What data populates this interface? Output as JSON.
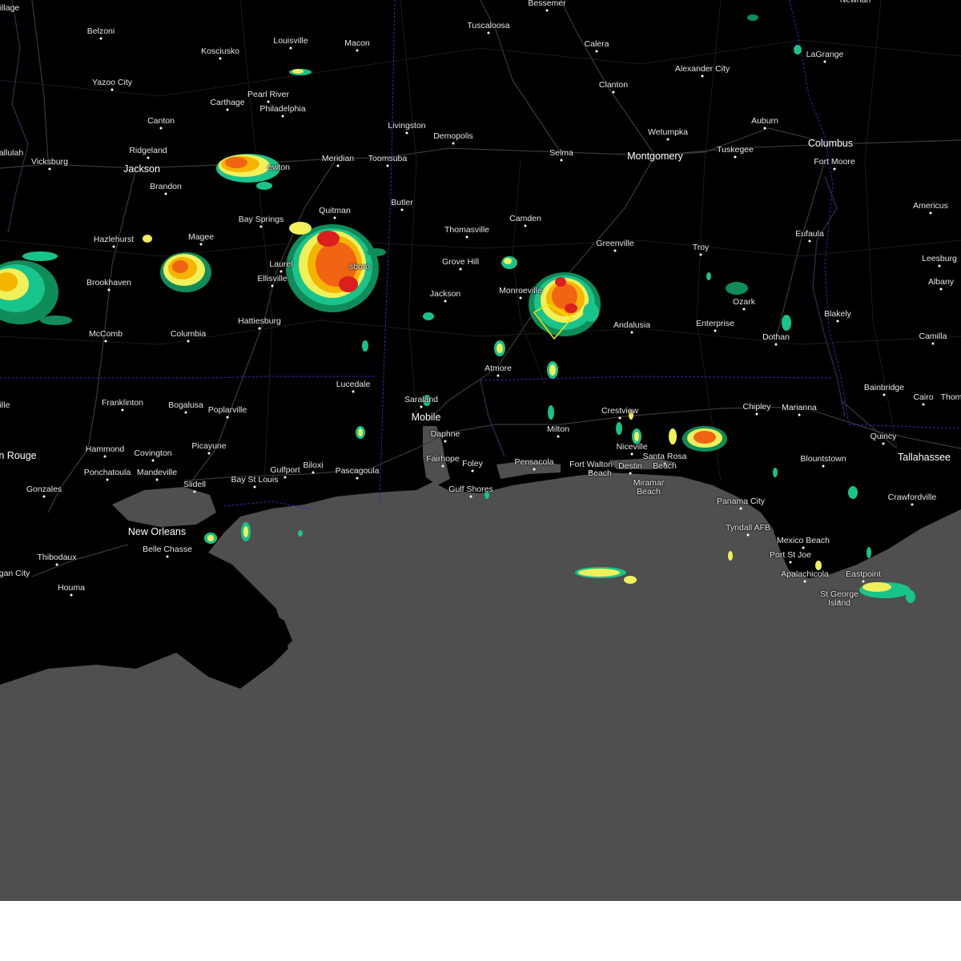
{
  "map": {
    "colors": {
      "land": "#000000",
      "water": "#4f4f4f",
      "roads": "#3a3a3a",
      "state_borders": "#2c2ca8",
      "warning_polygon": "#f2e600",
      "radar": [
        "#0f8c5a",
        "#19c38c",
        "#f0f05a",
        "#f5b400",
        "#f06414",
        "#dc1e1e"
      ]
    },
    "labels": [
      {
        "id": "bessemer",
        "text": "Bessemer"
      },
      {
        "id": "newnan",
        "text": "Newnan"
      },
      {
        "id": "tuscaloosa",
        "text": "Tuscaloosa"
      },
      {
        "id": "belzoni",
        "text": "Belzoni"
      },
      {
        "id": "louisville",
        "text": "Louisville"
      },
      {
        "id": "macon",
        "text": "Macon"
      },
      {
        "id": "calera",
        "text": "Calera"
      },
      {
        "id": "kosciusko",
        "text": "Kosciusko"
      },
      {
        "id": "lagrange",
        "text": "LaGrange"
      },
      {
        "id": "alexander-city",
        "text": "Alexander City"
      },
      {
        "id": "yazoo-city",
        "text": "Yazoo City"
      },
      {
        "id": "clanton",
        "text": "Clanton"
      },
      {
        "id": "pearl-river",
        "text": "Pearl River"
      },
      {
        "id": "carthage",
        "text": "Carthage"
      },
      {
        "id": "philadelphia",
        "text": "Philadelphia"
      },
      {
        "id": "canton",
        "text": "Canton"
      },
      {
        "id": "livingston",
        "text": "Livingston"
      },
      {
        "id": "auburn",
        "text": "Auburn"
      },
      {
        "id": "wetumpka",
        "text": "Wetumpka"
      },
      {
        "id": "demopolis",
        "text": "Demopolis"
      },
      {
        "id": "columbus",
        "text": "Columbus"
      },
      {
        "id": "ridgeland",
        "text": "Ridgeland"
      },
      {
        "id": "tuskegee",
        "text": "Tuskegee"
      },
      {
        "id": "tallulah",
        "text": "allulah"
      },
      {
        "id": "selma",
        "text": "Selma"
      },
      {
        "id": "montgomery",
        "text": "Montgomery"
      },
      {
        "id": "vicksburg",
        "text": "Vicksburg"
      },
      {
        "id": "meridian",
        "text": "Meridian"
      },
      {
        "id": "toomsuba",
        "text": "Toomsuba"
      },
      {
        "id": "fort-moore",
        "text": "Fort Moore"
      },
      {
        "id": "jackson-ms",
        "text": "Jackson"
      },
      {
        "id": "newton",
        "text": "ewton"
      },
      {
        "id": "brandon",
        "text": "Brandon"
      },
      {
        "id": "butler",
        "text": "Butler"
      },
      {
        "id": "americus",
        "text": "Americus"
      },
      {
        "id": "quitman",
        "text": "Quitman"
      },
      {
        "id": "camden",
        "text": "Camden"
      },
      {
        "id": "bay-springs",
        "text": "Bay Springs"
      },
      {
        "id": "thomasville",
        "text": "Thomasville"
      },
      {
        "id": "eufaula",
        "text": "Eufaula"
      },
      {
        "id": "hazlehurst",
        "text": "Hazlehurst"
      },
      {
        "id": "magee",
        "text": "Magee"
      },
      {
        "id": "greenville",
        "text": "Greenville"
      },
      {
        "id": "troy",
        "text": "Troy"
      },
      {
        "id": "leesburg",
        "text": "Leesburg"
      },
      {
        "id": "grove-hill",
        "text": "Grove Hill"
      },
      {
        "id": "waynesboro",
        "text": "sboro"
      },
      {
        "id": "laurel",
        "text": "Laurel"
      },
      {
        "id": "ellisville",
        "text": "Ellisville"
      },
      {
        "id": "brookhaven",
        "text": "Brookhaven"
      },
      {
        "id": "albany",
        "text": "Albany"
      },
      {
        "id": "monroeville",
        "text": "Monroeville"
      },
      {
        "id": "jackson-al",
        "text": "Jackson"
      },
      {
        "id": "ozark",
        "text": "Ozark"
      },
      {
        "id": "blakely",
        "text": "Blakely"
      },
      {
        "id": "andalusia",
        "text": "Andalusia"
      },
      {
        "id": "hattiesburg",
        "text": "Hattiesburg"
      },
      {
        "id": "enterprise",
        "text": "Enterprise"
      },
      {
        "id": "mccomb",
        "text": "McComb"
      },
      {
        "id": "columbia",
        "text": "Columbia"
      },
      {
        "id": "dothan",
        "text": "Dothan"
      },
      {
        "id": "camilla",
        "text": "Camilla"
      },
      {
        "id": "atmore",
        "text": "Atmore"
      },
      {
        "id": "lucedale",
        "text": "Lucedale"
      },
      {
        "id": "bainbridge",
        "text": "Bainbridge"
      },
      {
        "id": "cairo",
        "text": "Cairo"
      },
      {
        "id": "thomasville-ga",
        "text": "Thom"
      },
      {
        "id": "saraland",
        "text": "Saraland"
      },
      {
        "id": "franklinton",
        "text": "Franklinton"
      },
      {
        "id": "bogalusa",
        "text": "Bogalusa"
      },
      {
        "id": "chipley",
        "text": "Chipley"
      },
      {
        "id": "marianna",
        "text": "Marianna"
      },
      {
        "id": "crestview",
        "text": "Crestview"
      },
      {
        "id": "poplarville",
        "text": "Poplarville"
      },
      {
        "id": "mobile",
        "text": "Mobile"
      },
      {
        "id": "ville",
        "text": "ille"
      },
      {
        "id": "milton",
        "text": "Milton"
      },
      {
        "id": "daphne",
        "text": "Daphne"
      },
      {
        "id": "quincy",
        "text": "Quincy"
      },
      {
        "id": "picayune",
        "text": "Picayune"
      },
      {
        "id": "niceville",
        "text": "Niceville"
      },
      {
        "id": "hammond",
        "text": "Hammond"
      },
      {
        "id": "covington",
        "text": "Covington"
      },
      {
        "id": "baton-rouge",
        "text": "n Rouge"
      },
      {
        "id": "santa-rosa-beach",
        "text": "Santa Rosa"
      },
      {
        "id": "santa-rosa-beach-2",
        "text": "Beach"
      },
      {
        "id": "fairhope",
        "text": "Fairhope"
      },
      {
        "id": "blountstown",
        "text": "Blountstown"
      },
      {
        "id": "tallahassee",
        "text": "Tallahassee"
      },
      {
        "id": "pensacola",
        "text": "Pensacola"
      },
      {
        "id": "foley",
        "text": "Foley"
      },
      {
        "id": "fort-walton-beach",
        "text": "Fort Walton"
      },
      {
        "id": "fort-walton-beach-2",
        "text": "Beach"
      },
      {
        "id": "destin",
        "text": "Destin"
      },
      {
        "id": "ponchatoula",
        "text": "Ponchatoula"
      },
      {
        "id": "mandeville",
        "text": "Mandeville"
      },
      {
        "id": "gulfport",
        "text": "Gulfport"
      },
      {
        "id": "biloxi",
        "text": "Biloxi"
      },
      {
        "id": "pascagoula",
        "text": "Pascagoula"
      },
      {
        "id": "gonzales",
        "text": "Gonzales"
      },
      {
        "id": "slidell",
        "text": "Slidell"
      },
      {
        "id": "bay-st-louis",
        "text": "Bay St Louis"
      },
      {
        "id": "miramar-beach",
        "text": "Miramar"
      },
      {
        "id": "miramar-beach-2",
        "text": "Beach"
      },
      {
        "id": "gulf-shores",
        "text": "Gulf Shores"
      },
      {
        "id": "crawfordville",
        "text": "Crawfordville"
      },
      {
        "id": "panama-city",
        "text": "Panama City"
      },
      {
        "id": "new-orleans",
        "text": "New Orleans"
      },
      {
        "id": "tyndall-afb",
        "text": "Tyndall AFB"
      },
      {
        "id": "belle-chasse",
        "text": "Belle Chasse"
      },
      {
        "id": "mexico-beach",
        "text": "Mexico Beach"
      },
      {
        "id": "port-st-joe",
        "text": "Port St Joe"
      },
      {
        "id": "thibodaux",
        "text": "Thibodaux"
      },
      {
        "id": "apalachicola",
        "text": "Apalachicola"
      },
      {
        "id": "eastpoint",
        "text": "Eastpoint"
      },
      {
        "id": "morgan-city",
        "text": "gan City"
      },
      {
        "id": "houma",
        "text": "Houma"
      },
      {
        "id": "st-george-island",
        "text": "St George"
      },
      {
        "id": "st-george-island-2",
        "text": "Island"
      },
      {
        "id": "village",
        "text": "illage"
      }
    ]
  }
}
